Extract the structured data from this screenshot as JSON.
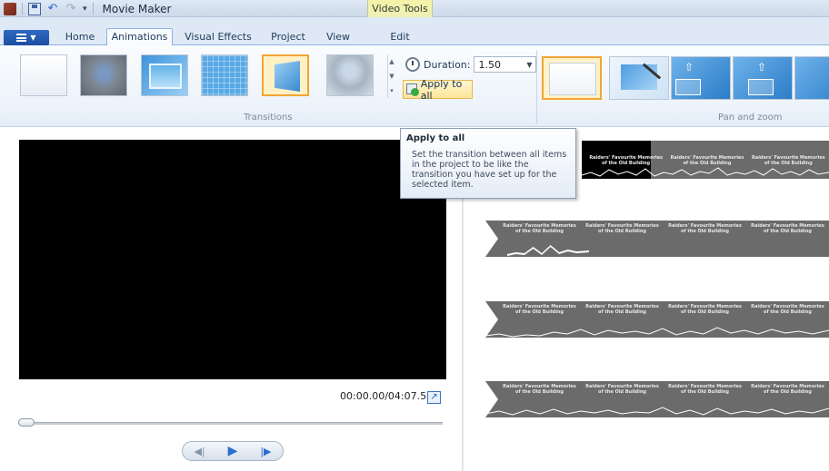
{
  "window": {
    "title": "Movie Maker",
    "context_tab_group": "Video Tools"
  },
  "quick_access": {
    "icons": [
      "app-icon",
      "save-icon",
      "undo-icon",
      "redo-icon",
      "customize-dropdown-icon"
    ]
  },
  "tabs": [
    {
      "label": "Home"
    },
    {
      "label": "Animations",
      "active": true
    },
    {
      "label": "Visual Effects"
    },
    {
      "label": "Project"
    },
    {
      "label": "View"
    },
    {
      "label": "Edit"
    }
  ],
  "ribbon": {
    "transitions_group_label": "Transitions",
    "pan_zoom_group_label": "Pan and zoom",
    "duration_label": "Duration:",
    "duration_value": "1.50",
    "apply_to_all_label": "Apply to all",
    "transition_thumbnails": [
      "none",
      "blur",
      "fade-in-frame",
      "mosaic",
      "perspective",
      "dissolve"
    ],
    "selected_transition_index": 4,
    "pan_zoom_thumbnails": [
      "none",
      "auto-pan-zoom",
      "pan-up-left",
      "pan-up-center",
      "pan-up-right"
    ]
  },
  "tooltip": {
    "title": "Apply to all",
    "body": "Set the transition between all items in the project to be like the transition you have set up for the selected item."
  },
  "player": {
    "time_readout": "00:00.00/04:07.56"
  },
  "storyboard": {
    "frame_caption": "Raiders' Favourite Memories of the Old Building"
  },
  "colors": {
    "selected_border": "#f3a436",
    "ribbon_bg": "#eef4fb",
    "context_tab": "#f6f3a8",
    "clip_bg": "#6b6b6b"
  }
}
